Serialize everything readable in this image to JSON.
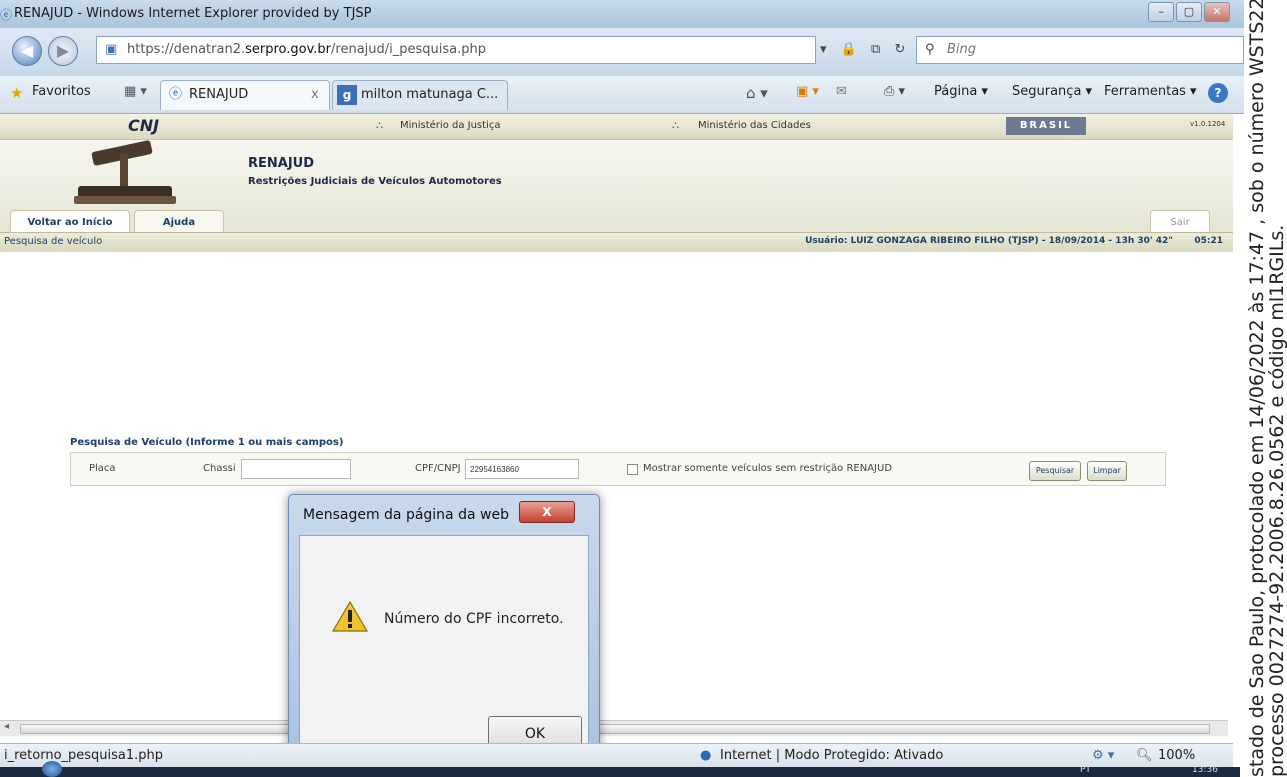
{
  "window": {
    "title": "RENAJUD - Windows Internet Explorer provided by TJSP"
  },
  "addressbar": {
    "url_prefix": "https://denatran2.",
    "url_domain": "serpro.gov.br",
    "url_path": "/renajud/i_pesquisa.php",
    "search_placeholder": "Bing"
  },
  "favorites": {
    "label": "Favoritos",
    "tabs": [
      {
        "label": "RENAJUD"
      },
      {
        "label": "milton matunaga C..."
      }
    ],
    "commands": {
      "page": "Página ▾",
      "security": "Segurança ▾",
      "tools": "Ferramentas ▾"
    }
  },
  "gov": {
    "cnj": "CNJ",
    "ministry_justice": "Ministério da Justiça",
    "ministry_cities": "Ministério das Cidades",
    "brasil": "BRASIL",
    "version": "v1.0.1204"
  },
  "site": {
    "title": "RENAJUD",
    "subtitle": "Restrições Judiciais de Veículos Automotores",
    "nav": {
      "home": "Voltar ao Início",
      "help": "Ajuda",
      "exit": "Sair"
    },
    "breadcrumb": "Pesquisa de veículo",
    "user_info": "Usuário: LUIZ GONZAGA RIBEIRO FILHO (TJSP) - 18/09/2014 - 13h 30' 42\"",
    "timer": "05:21"
  },
  "search": {
    "title": "Pesquisa de Veículo (Informe 1 ou mais campos)",
    "placa_label": "Placa",
    "placa_value": "",
    "chassi_label": "Chassi",
    "chassi_value": "",
    "cpf_label": "CPF/CNPJ",
    "cpf_value": "22954163860",
    "checkbox_label": "Mostrar somente veículos sem restrição RENAJUD",
    "search_button": "Pesquisar",
    "clear_button": "Limpar"
  },
  "dialog": {
    "title": "Mensagem da página da web",
    "close": "X",
    "message": "Número do CPF incorreto.",
    "ok": "OK"
  },
  "statusbar": {
    "url": "i_retorno_pesquisa1.php",
    "zone": "Internet | Modo Protegido: Ativado",
    "zoom": "100%"
  },
  "taskbar": {
    "lang": "PT",
    "time": "13:36"
  },
  "side_text": {
    "line1": "stado de Sao Paulo, protocolado em 14/06/2022 às 17:47 , sob o número WSTS22",
    "line2": "processo 0027274-92.2006.8.26.0562 e código ml1RGILs."
  },
  "colors": {
    "ie_chrome": "#c6d8e9",
    "site_header": "#e6e6d6",
    "dialog_frame": "#a9c1dd",
    "close_red": "#c44130"
  }
}
